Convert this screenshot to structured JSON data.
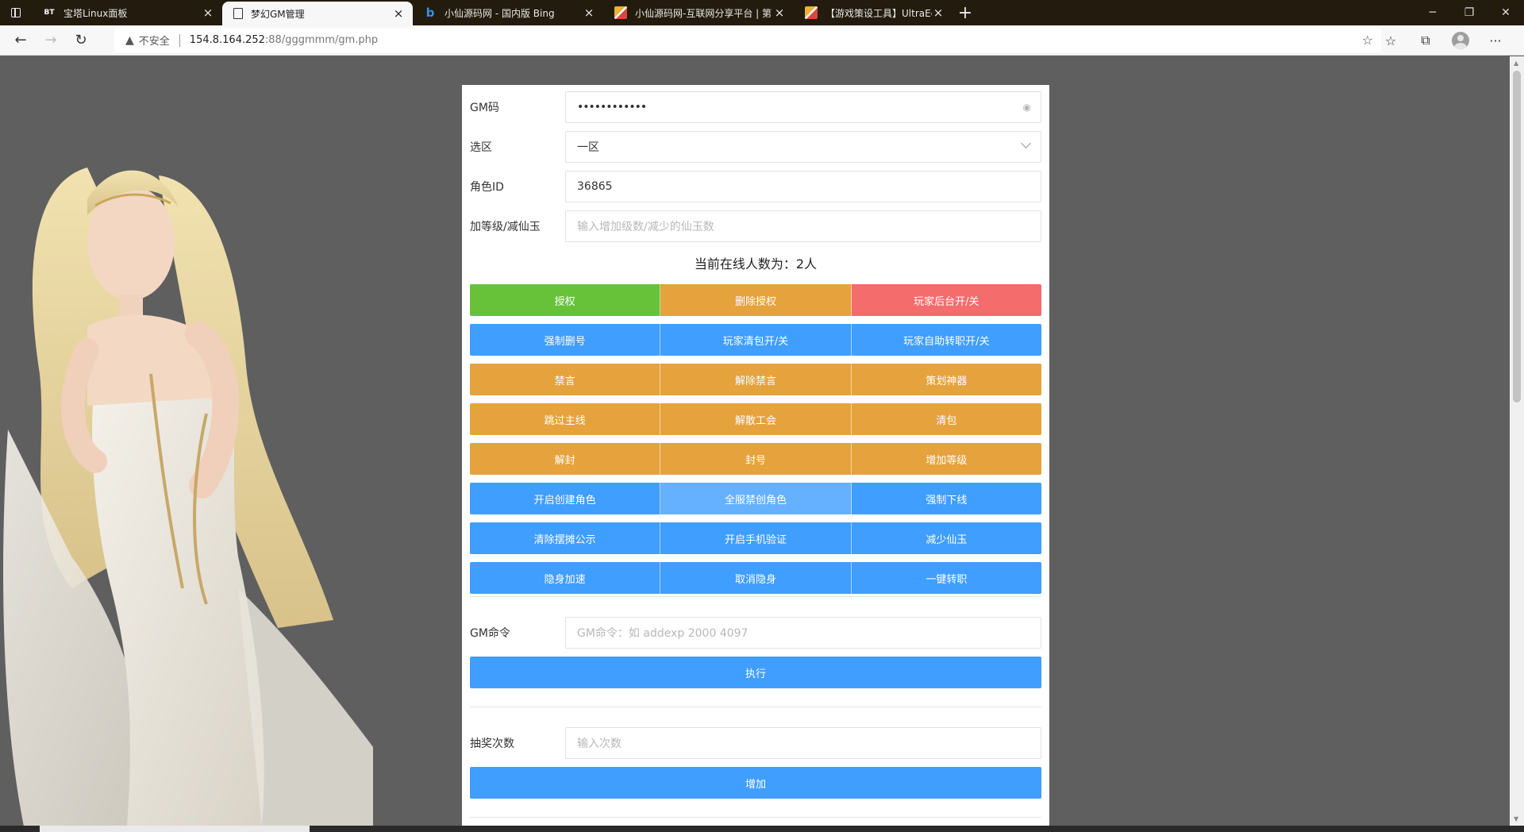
{
  "browser": {
    "tabs": [
      {
        "title": "宝塔Linux面板",
        "favicon": "BT",
        "active": false
      },
      {
        "title": "梦幻GM管理",
        "favicon": "doc",
        "active": true
      },
      {
        "title": "小仙源码网 - 国内版 Bing",
        "favicon": "bing",
        "active": false
      },
      {
        "title": "小仙源码网-互联网分享平台 | 第",
        "favicon": "pen",
        "active": false
      },
      {
        "title": "【游戏策设工具】UltraEdit(UE编",
        "favicon": "pen",
        "active": false
      }
    ],
    "address": {
      "warning_label": "不安全",
      "host": "154.8.164.252",
      "path": ":88/gggmmm/gm.php"
    },
    "icons": [
      "back-icon",
      "forward-icon",
      "reload-icon",
      "favorite-add-icon",
      "favorites-icon",
      "collections-icon",
      "profile-icon",
      "more-icon"
    ]
  },
  "form": {
    "gm_code": {
      "label": "GM码",
      "value": "••••••••••••"
    },
    "zone": {
      "label": "选区",
      "value": "一区"
    },
    "role_id": {
      "label": "角色ID",
      "value": "36865"
    },
    "level_jade": {
      "label": "加等级/减仙玉",
      "placeholder": "输入增加级数/减少的仙玉数"
    }
  },
  "online_text": "当前在线人数为：2人",
  "button_rows": [
    [
      {
        "label": "授权",
        "color": "#67c23a"
      },
      {
        "label": "删除授权",
        "color": "#e6a23c"
      },
      {
        "label": "玩家后台开/关",
        "color": "#f56c6c"
      }
    ],
    [
      {
        "label": "强制删号",
        "color": "#409eff"
      },
      {
        "label": "玩家清包开/关",
        "color": "#409eff"
      },
      {
        "label": "玩家自助转职开/关",
        "color": "#409eff"
      }
    ],
    [
      {
        "label": "禁言",
        "color": "#e6a23c"
      },
      {
        "label": "解除禁言",
        "color": "#e6a23c"
      },
      {
        "label": "策划神器",
        "color": "#e6a23c"
      }
    ],
    [
      {
        "label": "跳过主线",
        "color": "#e6a23c"
      },
      {
        "label": "解散工会",
        "color": "#e6a23c"
      },
      {
        "label": "清包",
        "color": "#e6a23c"
      }
    ],
    [
      {
        "label": "解封",
        "color": "#e6a23c"
      },
      {
        "label": "封号",
        "color": "#e6a23c"
      },
      {
        "label": "增加等级",
        "color": "#e6a23c"
      }
    ],
    [
      {
        "label": "开启创建角色",
        "color": "#409eff"
      },
      {
        "label": "全服禁创角色",
        "color": "#66b1ff"
      },
      {
        "label": "强制下线",
        "color": "#409eff"
      }
    ],
    [
      {
        "label": "清除摆摊公示",
        "color": "#409eff"
      },
      {
        "label": "开启手机验证",
        "color": "#409eff"
      },
      {
        "label": "减少仙玉",
        "color": "#409eff"
      }
    ],
    [
      {
        "label": "隐身加速",
        "color": "#409eff"
      },
      {
        "label": "取消隐身",
        "color": "#409eff"
      },
      {
        "label": "一键转职",
        "color": "#409eff"
      }
    ]
  ],
  "gm_command": {
    "label": "GM命令",
    "placeholder": "GM命令：如 addexp 2000 4097",
    "button": "执行"
  },
  "lottery": {
    "label": "抽奖次数",
    "placeholder": "输入次数",
    "button": "增加"
  }
}
